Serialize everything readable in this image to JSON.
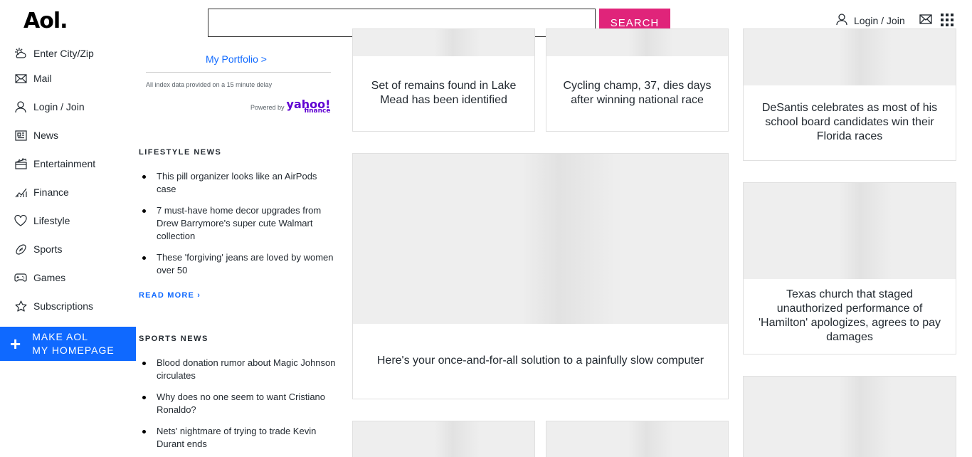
{
  "header": {
    "logo": "Aol.",
    "search_placeholder": "",
    "search_button": "SEARCH",
    "login_label": "Login / Join"
  },
  "sidebar": {
    "items": [
      {
        "label": "Enter City/Zip",
        "icon": "weather-icon"
      },
      {
        "label": "Mail",
        "icon": "mail-icon"
      },
      {
        "label": "Login / Join",
        "icon": "user-icon"
      },
      {
        "label": "News",
        "icon": "news-icon"
      },
      {
        "label": "Entertainment",
        "icon": "clapperboard-icon"
      },
      {
        "label": "Finance",
        "icon": "chart-icon"
      },
      {
        "label": "Lifestyle",
        "icon": "heart-icon"
      },
      {
        "label": "Sports",
        "icon": "football-icon"
      },
      {
        "label": "Games",
        "icon": "gamepad-icon"
      },
      {
        "label": "Subscriptions",
        "icon": "star-icon"
      }
    ],
    "make_home_line1": "MAKE AOL",
    "make_home_line2": "MY HOMEPAGE"
  },
  "finance": {
    "portfolio_link": "My Portfolio >",
    "delay_note": "All index data provided on a 15 minute delay",
    "powered_by": "Powered by",
    "yahoo_brand": "yahoo!",
    "yahoo_sub": "finance"
  },
  "lifestyle": {
    "title": "LIFESTYLE NEWS",
    "items": [
      "This pill organizer looks like an AirPods case",
      "7 must-have home decor upgrades from Drew Barrymore's super cute Walmart collection",
      "These 'forgiving' jeans are loved by women over 50"
    ],
    "read_more": "READ MORE ›"
  },
  "sports": {
    "title": "SPORTS NEWS",
    "items": [
      "Blood donation rumor about Magic Johnson circulates",
      "Why does no one seem to want Cristiano Ronaldo?",
      "Nets' nightmare of trying to trade Kevin Durant ends"
    ]
  },
  "cards": {
    "lake_mead": "Set of remains found in Lake Mead has been identified",
    "cycling": "Cycling champ, 37, dies days after winning national race",
    "desantis": "DeSantis celebrates as most of his school board candidates win their Florida races",
    "slow_computer": "Here's your once-and-for-all solution to a painfully slow computer",
    "texas_church": "Texas church that staged unauthorized performance of 'Hamilton' apologizes, agrees to pay damages"
  }
}
